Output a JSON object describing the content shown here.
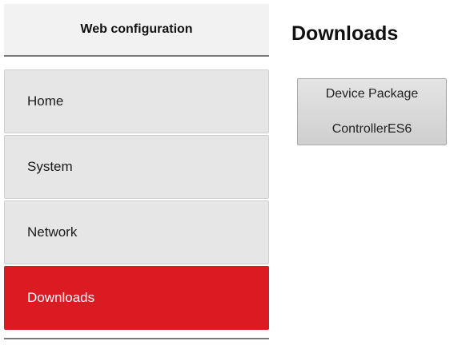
{
  "sidebar": {
    "title": "Web configuration",
    "items": [
      {
        "label": "Home",
        "active": false
      },
      {
        "label": "System",
        "active": false
      },
      {
        "label": "Network",
        "active": false
      },
      {
        "label": "Downloads",
        "active": true
      }
    ]
  },
  "main": {
    "title": "Downloads",
    "download_button": {
      "line1": "Device Package",
      "line2": "ControllerES6"
    }
  },
  "colors": {
    "accent": "#dc1a22",
    "nav_background": "#e6e6e6",
    "header_background": "#f2f2f2"
  }
}
